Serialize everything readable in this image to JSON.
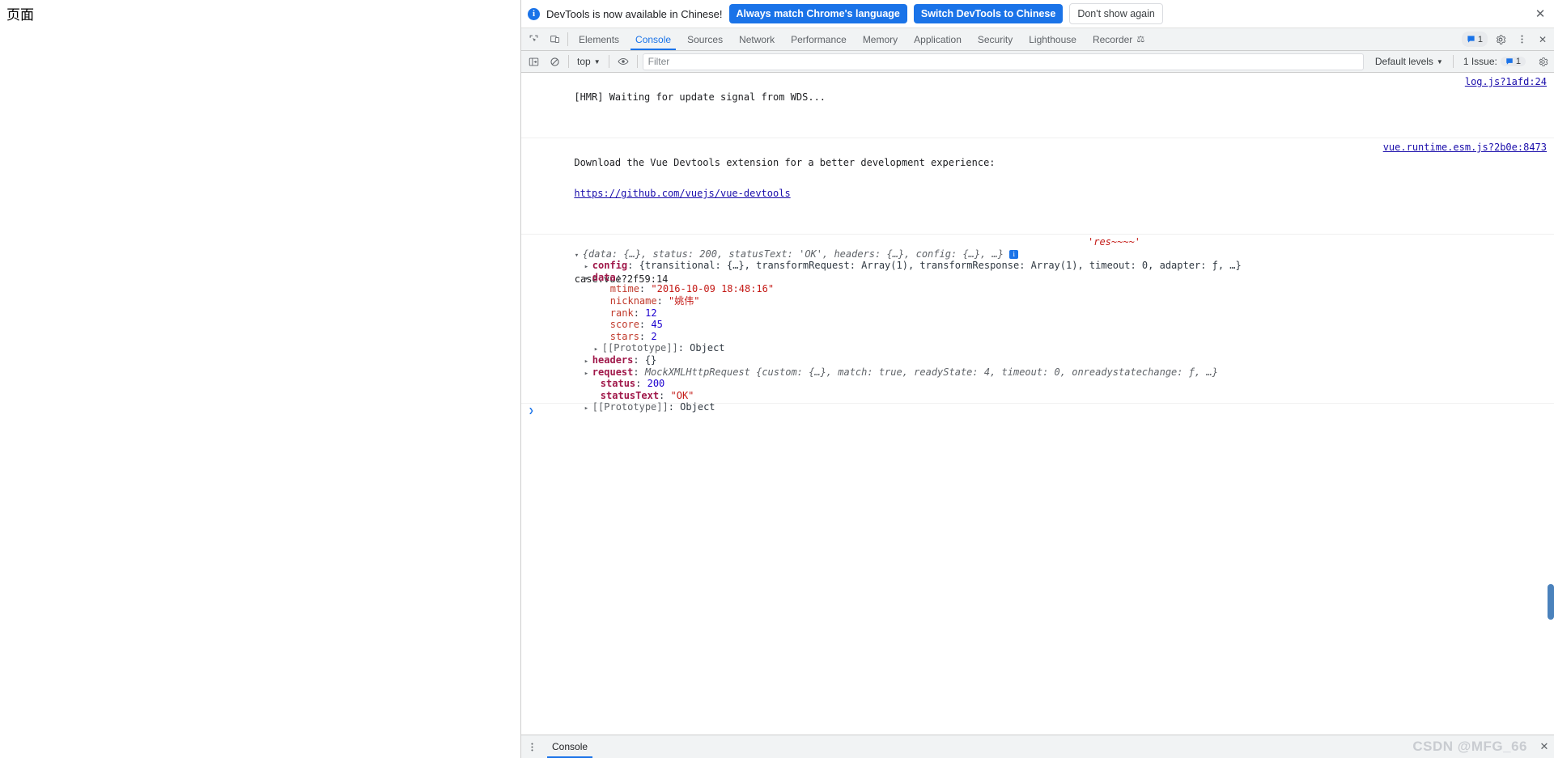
{
  "page": {
    "title": "页面"
  },
  "infobar": {
    "icon": "info-circle-icon",
    "message": "DevTools is now available in Chinese!",
    "primary_button": "Always match Chrome's language",
    "secondary_button": "Switch DevTools to Chinese",
    "dismiss_button": "Don't show again",
    "close_icon": "✕"
  },
  "tabstrip": {
    "inspect_icon": "inspect-cursor-icon",
    "device_icon": "device-toolbar-icon",
    "tabs": [
      {
        "label": "Elements",
        "active": false
      },
      {
        "label": "Console",
        "active": true
      },
      {
        "label": "Sources",
        "active": false
      },
      {
        "label": "Network",
        "active": false
      },
      {
        "label": "Performance",
        "active": false
      },
      {
        "label": "Memory",
        "active": false
      },
      {
        "label": "Application",
        "active": false
      },
      {
        "label": "Security",
        "active": false
      },
      {
        "label": "Lighthouse",
        "active": false
      },
      {
        "label": "Recorder",
        "active": false
      }
    ],
    "recorder_flask_icon": "flask-icon",
    "message_count": "1",
    "settings_icon": "gear-icon",
    "more_icon": "kebab-icon",
    "close_icon": "✕"
  },
  "console_toolbar": {
    "sidebar_icon": "console-sidebar-icon",
    "clear_icon": "clear-console-icon",
    "context": "top",
    "context_caret": "▼",
    "eye_icon": "live-expression-icon",
    "filter_placeholder": "Filter",
    "filter_value": "",
    "levels_label": "Default levels",
    "levels_caret": "▼",
    "issues_label": "1 Issue:",
    "issues_count": "1",
    "settings_icon": "gear-icon"
  },
  "console_messages": [
    {
      "text": "[HMR] Waiting for update signal from WDS...",
      "source": "log.js?1afd:24"
    },
    {
      "text": "Download the Vue Devtools extension for a better development experience:",
      "link": "https://github.com/vuejs/vue-devtools",
      "source": "vue.runtime.esm.js?2b0e:8473"
    }
  ],
  "object_log": {
    "source": "case.vue?2f59:14",
    "eval_label": "'res~~~~'",
    "header": {
      "triangle": "open",
      "preview": "{data: {…}, status: 200, statusText: 'OK', headers: {…}, config: {…}, …}",
      "info_badge": "i"
    },
    "rows": [
      {
        "indent": 1,
        "triangle": "closed",
        "key": "config",
        "key_style": "own",
        "value": "{transitional: {…}, transformRequest: Array(1), transformResponse: Array(1), timeout: 0, adapter: ƒ, …}",
        "value_style": "plain"
      },
      {
        "indent": 1,
        "triangle": "open",
        "key": "data",
        "key_style": "own",
        "value": "",
        "value_style": "plain"
      },
      {
        "indent": 2,
        "triangle": "blank",
        "key": "mtime",
        "key_style": "prop",
        "value": "\"2016-10-09 18:48:16\"",
        "value_style": "string"
      },
      {
        "indent": 2,
        "triangle": "blank",
        "key": "nickname",
        "key_style": "prop",
        "value": "\"姚伟\"",
        "value_style": "string"
      },
      {
        "indent": 2,
        "triangle": "blank",
        "key": "rank",
        "key_style": "prop",
        "value": "12",
        "value_style": "number"
      },
      {
        "indent": 2,
        "triangle": "blank",
        "key": "score",
        "key_style": "prop",
        "value": "45",
        "value_style": "number"
      },
      {
        "indent": 2,
        "triangle": "blank",
        "key": "stars",
        "key_style": "prop",
        "value": "2",
        "value_style": "number"
      },
      {
        "indent": 2,
        "triangle": "closed",
        "key": "[[Prototype]]",
        "key_style": "proto",
        "value": "Object",
        "value_style": "plain"
      },
      {
        "indent": 1,
        "triangle": "closed",
        "key": "headers",
        "key_style": "own",
        "value": "{}",
        "value_style": "plain"
      },
      {
        "indent": 1,
        "triangle": "closed",
        "key": "request",
        "key_style": "own",
        "value": "MockXMLHttpRequest {custom: {…}, match: true, readyState: 4, timeout: 0, onreadystatechange: ƒ, …}",
        "value_style": "mixed"
      },
      {
        "indent": 1,
        "triangle": "blank",
        "key": "status",
        "key_style": "own",
        "value": "200",
        "value_style": "number"
      },
      {
        "indent": 1,
        "triangle": "blank",
        "key": "statusText",
        "key_style": "own",
        "value": "\"OK\"",
        "value_style": "string"
      },
      {
        "indent": 1,
        "triangle": "closed",
        "key": "[[Prototype]]",
        "key_style": "proto",
        "value": "Object",
        "value_style": "plain"
      }
    ]
  },
  "prompt": {
    "caret": "❯",
    "value": ""
  },
  "drawer": {
    "kebab_icon": "kebab-icon",
    "tab_label": "Console",
    "close_icon": "✕"
  },
  "watermark": {
    "text": "CSDN @MFG_66"
  },
  "colors": {
    "accent": "#1a73e8",
    "toolbar_bg": "#f1f3f4",
    "border": "#cdcdcd",
    "link": "#1a0dab",
    "string": "#c41a16",
    "number": "#1c00cf",
    "own_prop": "#a0184a",
    "prop": "#c0392b"
  }
}
